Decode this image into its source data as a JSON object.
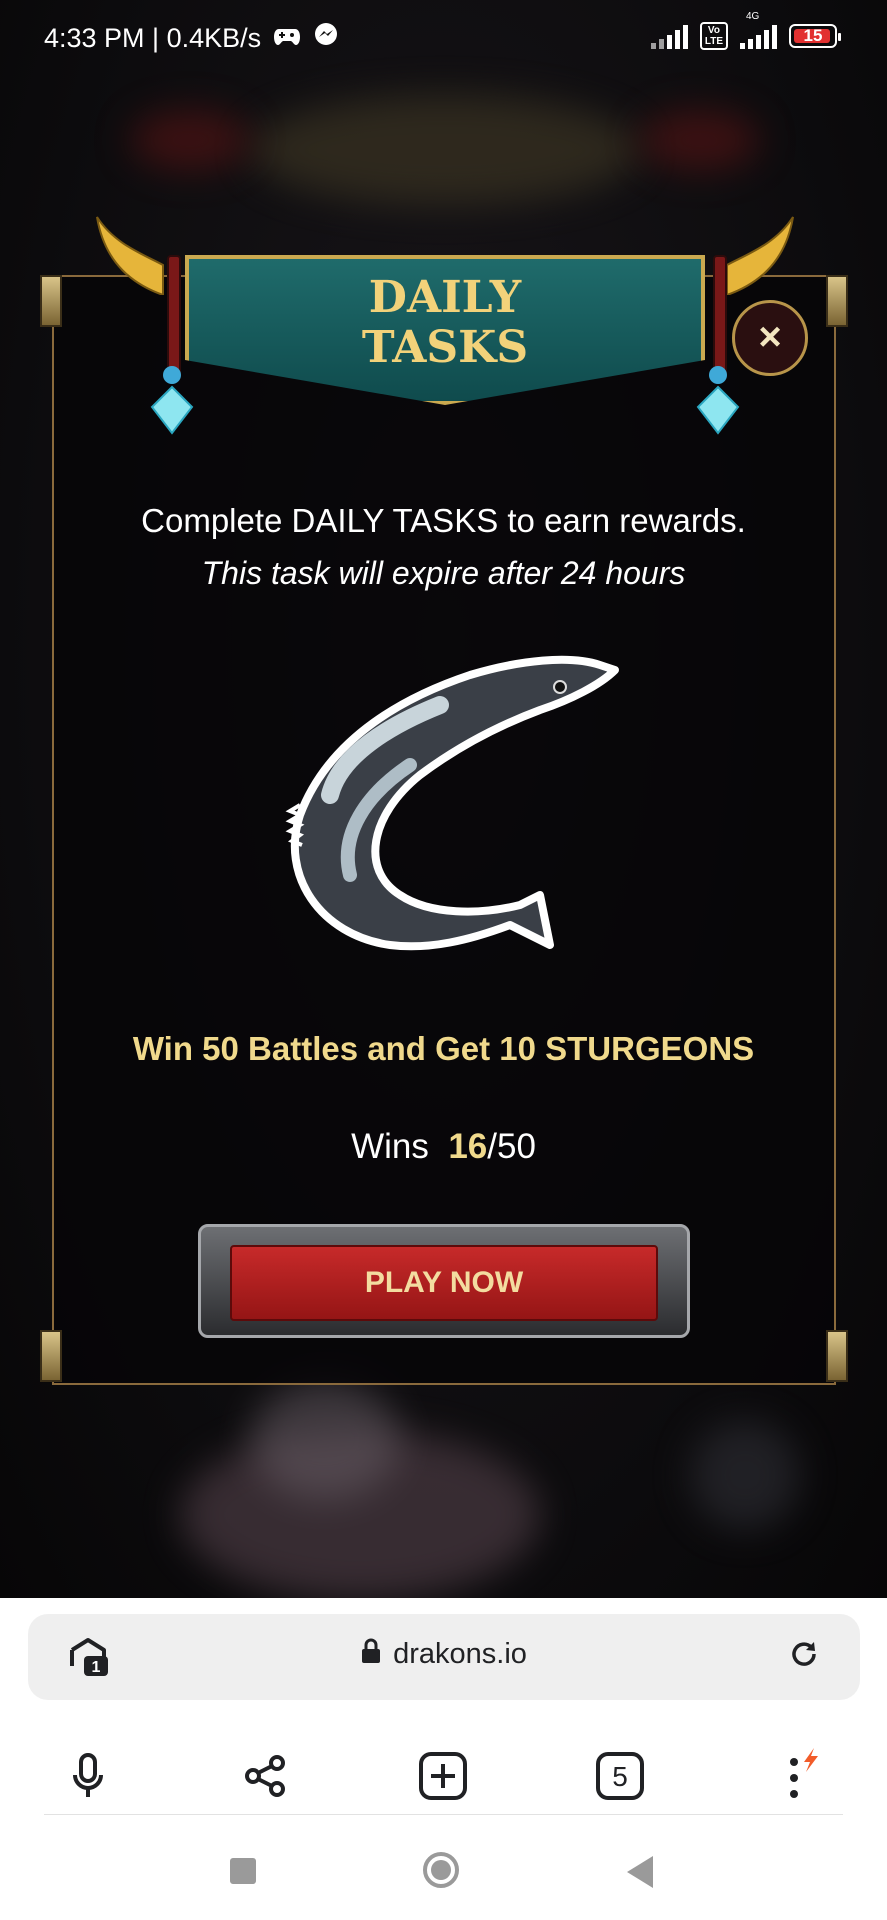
{
  "status_bar": {
    "time_speed": "4:33 PM | 0.4KB/s",
    "network_label": "4G",
    "volte_label": "Vo\nLTE",
    "battery": "15"
  },
  "dialog": {
    "title_line1": "DAILY",
    "title_line2": "TASKS",
    "close_label": "×",
    "subtitle": "Complete DAILY TASKS to earn rewards.",
    "subtitle_italic": "This task will expire after 24 hours",
    "task_text": "Win 50 Battles and Get 10 STURGEONS",
    "wins_label": "Wins",
    "wins_current": "16",
    "wins_total": "/50",
    "play_label": "PLAY NOW",
    "reward_icon": "sturgeon-fish-icon"
  },
  "browser": {
    "url": "drakons.io",
    "tab_badge": "1",
    "tabs_count": "5",
    "icons": [
      "mic-icon",
      "share-icon",
      "new-tab-icon",
      "tabs-icon",
      "menu-icon"
    ]
  },
  "colors": {
    "accent_gold": "#f0d98c",
    "play_red": "#c72a2a",
    "banner_teal": "#1f6b6b"
  }
}
